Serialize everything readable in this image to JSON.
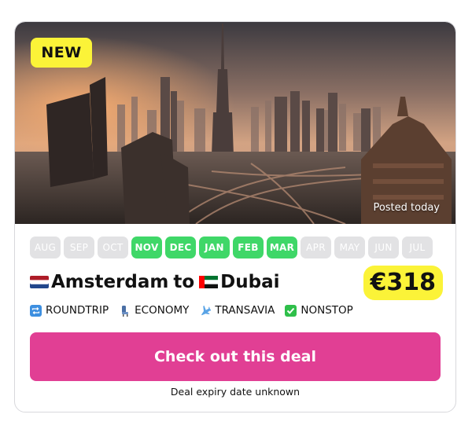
{
  "badge": {
    "label": "NEW"
  },
  "hero": {
    "posted_label": "Posted today"
  },
  "months": [
    {
      "label": "AUG",
      "active": false
    },
    {
      "label": "SEP",
      "active": false
    },
    {
      "label": "OCT",
      "active": false
    },
    {
      "label": "NOV",
      "active": true
    },
    {
      "label": "DEC",
      "active": true
    },
    {
      "label": "JAN",
      "active": true
    },
    {
      "label": "FEB",
      "active": true
    },
    {
      "label": "MAR",
      "active": true
    },
    {
      "label": "APR",
      "active": false
    },
    {
      "label": "MAY",
      "active": false
    },
    {
      "label": "JUN",
      "active": false
    },
    {
      "label": "JUL",
      "active": false
    }
  ],
  "route": {
    "origin": "Amsterdam",
    "connector": "to",
    "destination": "Dubai",
    "origin_flag_icon": "netherlands-flag-icon",
    "destination_flag_icon": "uae-flag-icon"
  },
  "price": {
    "value": "€318"
  },
  "tags": [
    {
      "label": "ROUNDTRIP",
      "icon": "repeat-icon"
    },
    {
      "label": "ECONOMY",
      "icon": "seat-icon"
    },
    {
      "label": "TRANSAVIA",
      "icon": "airplane-icon"
    },
    {
      "label": "NONSTOP",
      "icon": "check-mark-icon"
    }
  ],
  "cta": {
    "label": "Check out this deal"
  },
  "expiry": {
    "text": "Deal expiry date unknown"
  },
  "colors": {
    "badge_yellow": "#fbf338",
    "month_active": "#3fd768",
    "month_inactive": "#e2e2e4",
    "cta_pink": "#e13f94"
  }
}
